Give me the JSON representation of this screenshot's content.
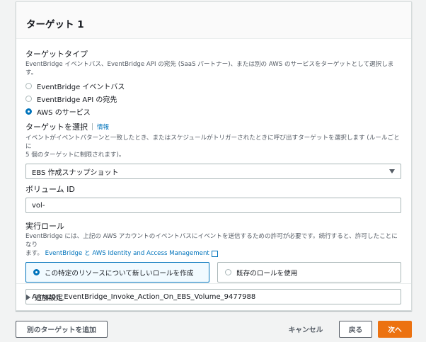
{
  "panel": {
    "title": "ターゲット 1"
  },
  "target_type": {
    "label": "ターゲットタイプ",
    "description": "EventBridge イベントバス、EventBridge API の宛先 (SaaS パートナー)、または別の AWS のサービスをターゲットとして選択します。",
    "options": [
      {
        "label": "EventBridge イベントバス",
        "checked": false
      },
      {
        "label": "EventBridge API の宛先",
        "checked": false
      },
      {
        "label": "AWS のサービス",
        "checked": true
      }
    ]
  },
  "select_target": {
    "label": "ターゲットを選択",
    "info": "情報",
    "description_line1": "イベントがイベントパターンと一致したとき、またはスケジュールがトリガーされたときに呼び出すターゲットを選択します (ルールごとに",
    "description_line2": "5 個のターゲットに制限されます)。",
    "value": "EBS 作成スナップショット"
  },
  "volume": {
    "label": "ボリューム ID",
    "value": "vol-"
  },
  "role": {
    "label": "実行ロール",
    "description": "EventBridge には、上記の AWS アカウントのイベントバスにイベントを送信するための許可が必要です。続行すると、許可したことになり",
    "description_tail": "ます。",
    "link": "EventBridge と AWS Identity and Access Management",
    "tiles": [
      {
        "label": "この特定のリソースについて新しいロールを作成",
        "checked": true
      },
      {
        "label": "既存のロールを使用",
        "checked": false
      }
    ],
    "role_name": "Amazon_EventBridge_Invoke_Action_On_EBS_Volume_9477988"
  },
  "additional_settings": {
    "label": "追加設定"
  },
  "footer": {
    "add_target": "別のターゲットを追加",
    "cancel": "キャンセル",
    "back": "戻る",
    "next": "次へ"
  },
  "colors": {
    "accent": "#0073bb",
    "primary_button": "#ec7211"
  }
}
